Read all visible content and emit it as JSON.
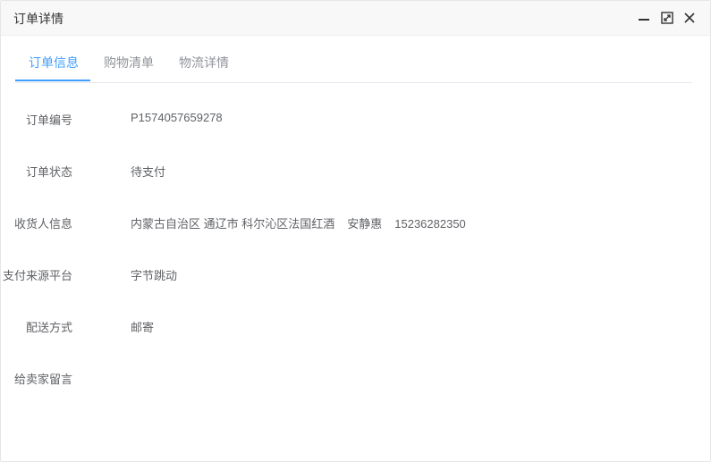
{
  "window": {
    "title": "订单详情",
    "icons": {
      "minimize": "minimize-icon",
      "maximize": "maximize-icon",
      "close": "close-icon"
    }
  },
  "tabs": [
    {
      "label": "订单信息",
      "active": true
    },
    {
      "label": "购物清单",
      "active": false
    },
    {
      "label": "物流详情",
      "active": false
    }
  ],
  "colors": {
    "accent": "#409eff",
    "titlebar_bg": "#f8f8f8",
    "text": "#606266"
  },
  "order": {
    "number_label": "订单编号",
    "number_value": "P1574057659278",
    "status_label": "订单状态",
    "status_value": "待支付",
    "receiver_label": "收货人信息",
    "receiver_address": "内蒙古自治区 通辽市 科尔沁区法国红酒",
    "receiver_name": "安静惠",
    "receiver_phone": "15236282350",
    "platform_label": "支付来源平台",
    "platform_value": "字节跳动",
    "delivery_label": "配送方式",
    "delivery_value": "邮寄",
    "message_label": "给卖家留言",
    "message_value": ""
  }
}
